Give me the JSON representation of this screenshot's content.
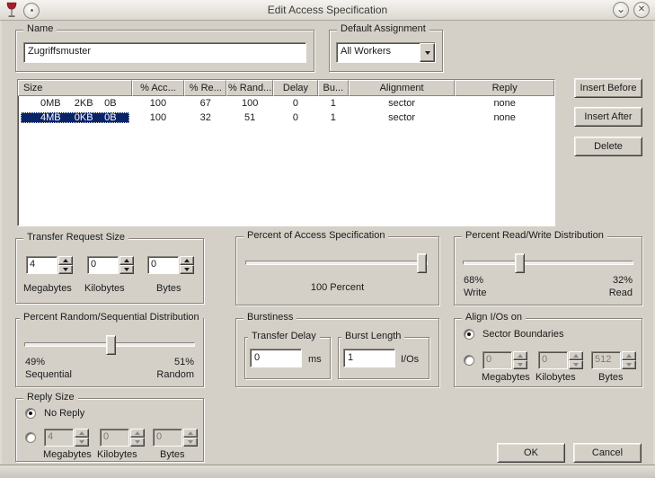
{
  "titlebar": {
    "title": "Edit Access Specification",
    "app_icon": "wine-glass",
    "pin_glyph": "",
    "shade_glyph": "⌄",
    "close_glyph": "✕"
  },
  "name_group": {
    "label": "Name",
    "value": "Zugriffsmuster"
  },
  "default_assignment": {
    "label": "Default Assignment",
    "value": "All Workers"
  },
  "spec_table": {
    "columns": [
      "Size",
      "% Acc...",
      "% Re...",
      "% Rand...",
      "Delay",
      "Bu...",
      "Alignment",
      "Reply"
    ],
    "rows": [
      {
        "selected": false,
        "cells": {
          "size_mb": "0MB",
          "size_kb": "2KB",
          "size_b": "0B",
          "access": "100",
          "read": "67",
          "random": "100",
          "delay": "0",
          "burst": "1",
          "alignment": "sector",
          "reply": "none"
        }
      },
      {
        "selected": true,
        "cells": {
          "size_mb": "4MB",
          "size_kb": "0KB",
          "size_b": "0B",
          "access": "100",
          "read": "32",
          "random": "51",
          "delay": "0",
          "burst": "1",
          "alignment": "sector",
          "reply": "none"
        }
      }
    ]
  },
  "list_buttons": {
    "insert_before": "Insert Before",
    "insert_after": "Insert After",
    "delete": "Delete"
  },
  "transfer_request_size": {
    "label": "Transfer Request Size",
    "megabytes": "4",
    "kilobytes": "0",
    "bytes": "0",
    "unit_labels": [
      "Megabytes",
      "Kilobytes",
      "Bytes"
    ]
  },
  "percent_access": {
    "label": "Percent of Access Specification",
    "value_label": "100 Percent",
    "slider_percent": 100
  },
  "percent_read_write": {
    "label": "Percent Read/Write Distribution",
    "slider_percent": 32,
    "left_percent": "68%",
    "left_label": "Write",
    "right_percent": "32%",
    "right_label": "Read"
  },
  "percent_random": {
    "label": "Percent Random/Sequential Distribution",
    "slider_percent": 51,
    "left_percent": "49%",
    "left_label": "Sequential",
    "right_percent": "51%",
    "right_label": "Random"
  },
  "burstiness": {
    "label": "Burstiness",
    "transfer_delay": {
      "label": "Transfer Delay",
      "value": "0",
      "unit": "ms"
    },
    "burst_length": {
      "label": "Burst Length",
      "value": "1",
      "unit": "I/Os"
    }
  },
  "align_ios": {
    "label": "Align I/Os on",
    "option1": "Sector Boundaries",
    "option1_selected": true,
    "option2_selected": false,
    "megabytes": "0",
    "kilobytes": "0",
    "bytes": "512",
    "unit_labels": [
      "Megabytes",
      "Kilobytes",
      "Bytes"
    ]
  },
  "reply_size": {
    "label": "Reply Size",
    "option1": "No Reply",
    "option1_selected": true,
    "option2_selected": false,
    "megabytes": "4",
    "kilobytes": "0",
    "bytes": "0",
    "unit_labels": [
      "Megabytes",
      "Kilobytes",
      "Bytes"
    ]
  },
  "dialog_buttons": {
    "ok": "OK",
    "cancel": "Cancel"
  },
  "colors": {
    "dialog_face": "#d4d0c8",
    "selection": "#0a246a",
    "selection_text": "#ffffff",
    "disabled_text": "#7f7b73",
    "titlebar_text": "#3c3b37",
    "wine_red": "#a31e2a"
  }
}
